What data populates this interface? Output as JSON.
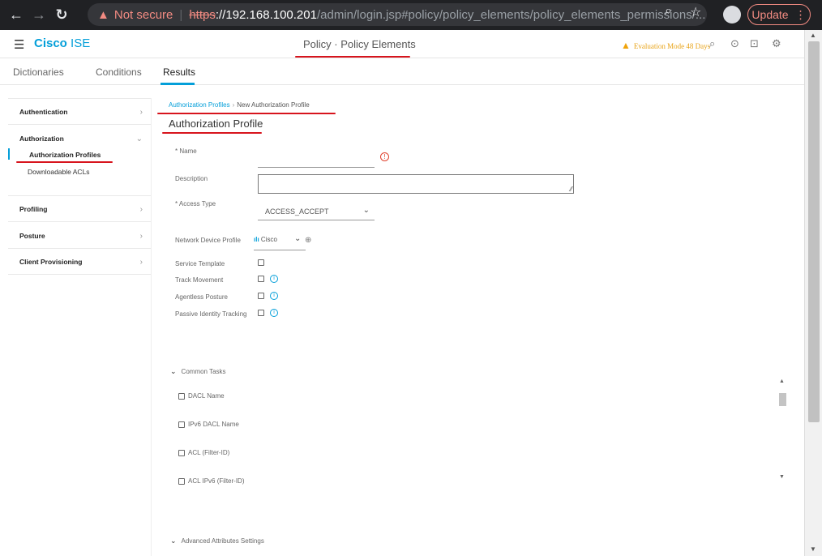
{
  "browser": {
    "not_secure": "Not secure",
    "separator": "|",
    "scheme": "https",
    "host": "://192.168.100.201",
    "path": "/admin/login.jsp#policy/policy_elements/policy_elements_permissions/...",
    "update_label": "Update"
  },
  "app": {
    "brand_bold": "Cisco",
    "brand_rest": " ISE",
    "page_title": "Policy · Policy Elements",
    "eval_notice": "Evaluation Mode 48 Days"
  },
  "subnav": {
    "tabs": [
      "Dictionaries",
      "Conditions",
      "Results"
    ]
  },
  "sidebar": {
    "sections": [
      "Authentication",
      "Authorization",
      "Profiling",
      "Posture",
      "Client Provisioning"
    ],
    "auth_items": [
      "Authorization Profiles",
      "Downloadable ACLs"
    ]
  },
  "breadcrumb": {
    "parent": "Authorization Profiles",
    "current": "New Authorization Profile"
  },
  "form": {
    "title": "Authorization Profile",
    "name_label": "* Name",
    "description_label": "Description",
    "access_type_label": "* Access Type",
    "access_type_value": "ACCESS_ACCEPT",
    "ndp_label": "Network Device Profile",
    "ndp_value": "Cisco",
    "service_template_label": "Service Template",
    "track_movement_label": "Track Movement",
    "agentless_posture_label": "Agentless Posture",
    "passive_identity_label": "Passive Identity Tracking"
  },
  "common_tasks": {
    "header": "Common Tasks",
    "items": [
      "DACL Name",
      "IPv6 DACL Name",
      "ACL  (Filter-ID)",
      "ACL IPv6 (Filter-ID)"
    ]
  },
  "advanced": {
    "header": "Advanced Attributes Settings"
  },
  "colors": {
    "accent": "#049fd9",
    "annotation": "#d7141d",
    "warning": "#f0a30a"
  }
}
